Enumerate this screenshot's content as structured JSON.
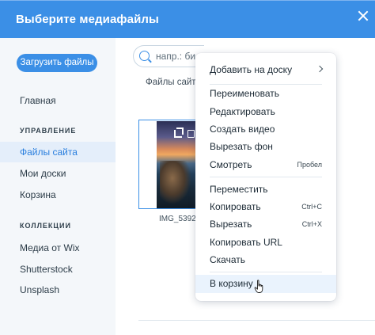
{
  "header": {
    "title": "Выберите медиафайлы"
  },
  "sidebar": {
    "upload_button": "Загрузить файлы",
    "main_item": "Главная",
    "section_manage": "УПРАВЛЕНИЕ",
    "manage_items": [
      "Файлы сайта",
      "Мои доски",
      "Корзина"
    ],
    "section_collections": "КОЛЛЕКЦИИ",
    "collection_items": [
      "Медиа от Wix",
      "Shutterstock",
      "Unsplash"
    ]
  },
  "search": {
    "placeholder": "напр.: би"
  },
  "content": {
    "section_label": "Файлы сайта",
    "thumbnail_name": "IMG_5392"
  },
  "context_menu": {
    "add_to_board": "Добавить на доску",
    "rename": "Переименовать",
    "edit": "Редактировать",
    "create_video": "Создать видео",
    "remove_background": "Вырезать фон",
    "view": "Смотреть",
    "view_shortcut": "Пробел",
    "move": "Переместить",
    "copy": "Копировать",
    "copy_shortcut": "Ctrl+C",
    "cut": "Вырезать",
    "cut_shortcut": "Ctrl+X",
    "copy_url": "Копировать URL",
    "download": "Скачать",
    "trash": "В корзину"
  },
  "colors": {
    "accent": "#3b8fe6",
    "sidebar_bg": "#f4f7fa",
    "active_bg": "#e4eefa",
    "hover_bg": "#eaf3fd"
  }
}
